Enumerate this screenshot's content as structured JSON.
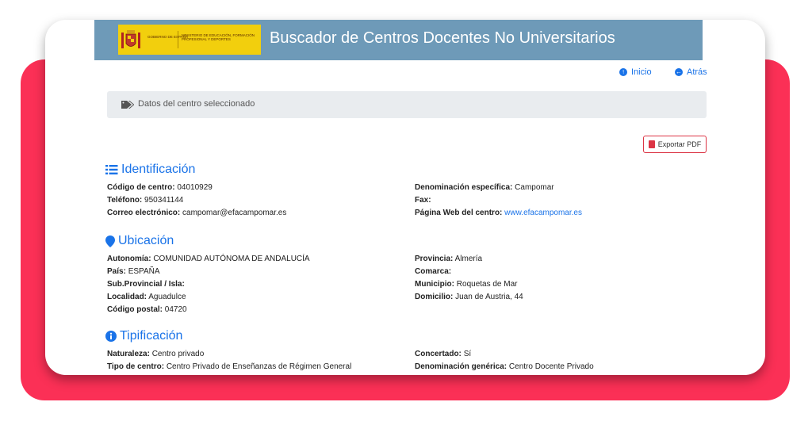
{
  "header": {
    "title": "Buscador de Centros Docentes No Universitarios",
    "logo_gobierno": "GOBIERNO DE ESPAÑA",
    "logo_ministerio": "MINISTERIO DE EDUCACIÓN, FORMACIÓN PROFESIONAL Y DEPORTES"
  },
  "nav": {
    "inicio": "Inicio",
    "atras": "Atrás"
  },
  "breadcrumb": "Datos del centro seleccionado",
  "export_pdf": "Exportar PDF",
  "sections": {
    "identificacion": {
      "title": "Identificación",
      "codigo_label": "Código de centro:",
      "codigo": "04010929",
      "telefono_label": "Teléfono:",
      "telefono": "950341144",
      "correo_label": "Correo electrónico:",
      "correo": "campomar@efacampomar.es",
      "denominacion_label": "Denominación específica:",
      "denominacion": "Campomar",
      "fax_label": "Fax:",
      "fax": "",
      "web_label": "Página Web del centro:",
      "web": "www.efacampomar.es"
    },
    "ubicacion": {
      "title": "Ubicación",
      "autonomia_label": "Autonomía:",
      "autonomia": "COMUNIDAD AUTÓNOMA DE ANDALUCÍA",
      "pais_label": "País:",
      "pais": "ESPAÑA",
      "subprov_label": "Sub.Provincial / Isla:",
      "subprov": "",
      "localidad_label": "Localidad:",
      "localidad": "Aguadulce",
      "cp_label": "Código postal:",
      "cp": "04720",
      "provincia_label": "Provincia:",
      "provincia": "Almería",
      "comarca_label": "Comarca:",
      "comarca": "",
      "municipio_label": "Municipio:",
      "municipio": "Roquetas de Mar",
      "domicilio_label": "Domicilio:",
      "domicilio": "Juan de Austria, 44"
    },
    "tipificacion": {
      "title": "Tipificación",
      "naturaleza_label": "Naturaleza:",
      "naturaleza": "Centro privado",
      "tipo_label": "Tipo de centro:",
      "tipo": "Centro Privado de Enseñanzas de Régimen General",
      "concertado_label": "Concertado:",
      "concertado": "Sí",
      "generica_label": "Denominación genérica:",
      "generica": "Centro Docente Privado"
    }
  },
  "colors": {
    "accent": "#1a73e8",
    "header": "#6e9ab8",
    "background_card": "#fb3056",
    "pdf": "#dc3545"
  }
}
